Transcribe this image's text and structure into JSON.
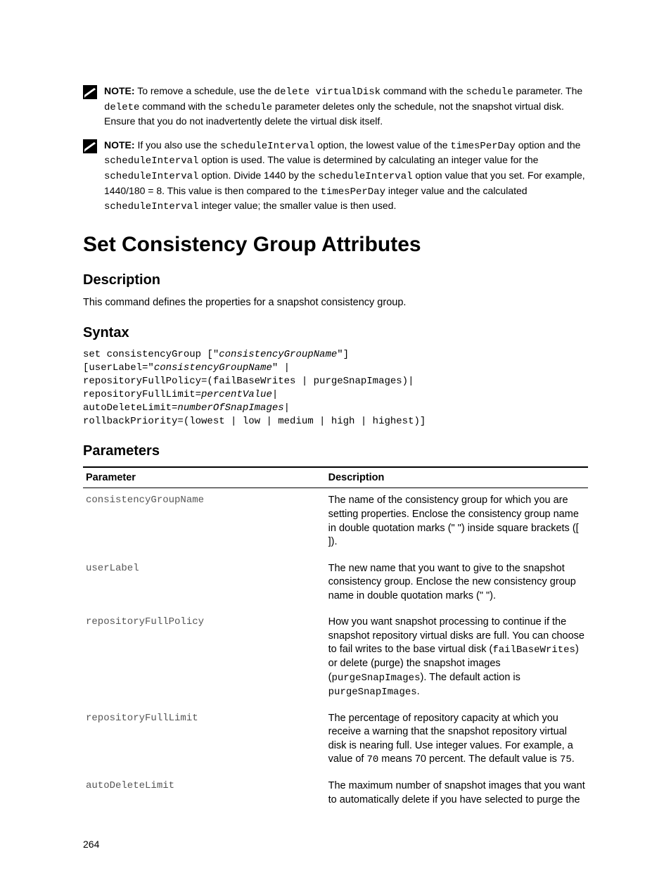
{
  "notes": [
    {
      "label": "NOTE:",
      "segments": [
        {
          "t": "plain",
          "v": " To remove a schedule, use the "
        },
        {
          "t": "mono",
          "v": "delete virtualDisk"
        },
        {
          "t": "plain",
          "v": " command with the "
        },
        {
          "t": "mono",
          "v": "schedule"
        },
        {
          "t": "plain",
          "v": " parameter. The "
        },
        {
          "t": "mono",
          "v": "delete"
        },
        {
          "t": "plain",
          "v": " command with the "
        },
        {
          "t": "mono",
          "v": "schedule"
        },
        {
          "t": "plain",
          "v": " parameter deletes only the schedule, not the snapshot virtual disk. Ensure that you do not inadvertently delete the virtual disk itself."
        }
      ]
    },
    {
      "label": "NOTE:",
      "segments": [
        {
          "t": "plain",
          "v": " If you also use the "
        },
        {
          "t": "mono",
          "v": "scheduleInterval"
        },
        {
          "t": "plain",
          "v": " option, the lowest value of the "
        },
        {
          "t": "mono",
          "v": "timesPerDay"
        },
        {
          "t": "plain",
          "v": " option and the "
        },
        {
          "t": "mono",
          "v": "scheduleInterval"
        },
        {
          "t": "plain",
          "v": " option is used. The value is determined by calculating an integer value for the "
        },
        {
          "t": "mono",
          "v": "scheduleInterval"
        },
        {
          "t": "plain",
          "v": " option. Divide 1440 by the "
        },
        {
          "t": "mono",
          "v": "scheduleInterval"
        },
        {
          "t": "plain",
          "v": " option value that you set. For example, 1440/180 = 8. This value is then compared to the "
        },
        {
          "t": "mono",
          "v": "timesPerDay"
        },
        {
          "t": "plain",
          "v": " integer value and the calculated "
        },
        {
          "t": "mono",
          "v": "scheduleInterval"
        },
        {
          "t": "plain",
          "v": " integer value; the smaller value is then used."
        }
      ]
    }
  ],
  "h1": "Set Consistency Group Attributes",
  "sections": {
    "description_heading": "Description",
    "description_body": "This command defines the properties for a snapshot consistency group.",
    "syntax_heading": "Syntax",
    "syntax_lines": [
      [
        {
          "t": "plain",
          "v": "set consistencyGroup [\""
        },
        {
          "t": "ital",
          "v": "consistencyGroupName"
        },
        {
          "t": "plain",
          "v": "\"]"
        }
      ],
      [
        {
          "t": "plain",
          "v": "[userLabel=\""
        },
        {
          "t": "ital",
          "v": "consistencyGroupName"
        },
        {
          "t": "plain",
          "v": "\" |"
        }
      ],
      [
        {
          "t": "plain",
          "v": "repositoryFullPolicy=(failBaseWrites | purgeSnapImages)|"
        }
      ],
      [
        {
          "t": "plain",
          "v": "repositoryFullLimit="
        },
        {
          "t": "ital",
          "v": "percentValue"
        },
        {
          "t": "plain",
          "v": "|"
        }
      ],
      [
        {
          "t": "plain",
          "v": "autoDeleteLimit="
        },
        {
          "t": "ital",
          "v": "numberOfSnapImages"
        },
        {
          "t": "plain",
          "v": "|"
        }
      ],
      [
        {
          "t": "plain",
          "v": "rollbackPriority=(lowest | low | medium | high | highest)]"
        }
      ]
    ],
    "parameters_heading": "Parameters"
  },
  "table": {
    "headers": [
      "Parameter",
      "Description"
    ],
    "rows": [
      {
        "param": "consistencyGroupName",
        "desc_segments": [
          {
            "t": "plain",
            "v": "The name of the consistency group for which you are setting properties. Enclose the consistency group name in double quotation marks (\" \") inside square brackets ([ ])."
          }
        ]
      },
      {
        "param": "userLabel",
        "desc_segments": [
          {
            "t": "plain",
            "v": "The new name that you want to give to the snapshot consistency group. Enclose the new consistency group name in double quotation marks (\" \")."
          }
        ]
      },
      {
        "param": "repositoryFullPolicy",
        "desc_segments": [
          {
            "t": "plain",
            "v": "How you want snapshot processing to continue if the snapshot repository virtual disks are full. You can choose to fail writes to the base virtual disk ("
          },
          {
            "t": "mono",
            "v": "failBaseWrites"
          },
          {
            "t": "plain",
            "v": ") or delete (purge) the snapshot images ("
          },
          {
            "t": "mono",
            "v": "purgeSnapImages"
          },
          {
            "t": "plain",
            "v": "). The default action is "
          },
          {
            "t": "mono",
            "v": "purgeSnapImages"
          },
          {
            "t": "plain",
            "v": "."
          }
        ]
      },
      {
        "param": "repositoryFullLimit",
        "desc_segments": [
          {
            "t": "plain",
            "v": "The percentage of repository capacity at which you receive a warning that the snapshot repository virtual disk is nearing full. Use integer values. For example, a value of "
          },
          {
            "t": "mono",
            "v": "70"
          },
          {
            "t": "plain",
            "v": " means 70 percent. The default value is "
          },
          {
            "t": "mono",
            "v": "75"
          },
          {
            "t": "plain",
            "v": "."
          }
        ]
      },
      {
        "param": "autoDeleteLimit",
        "desc_segments": [
          {
            "t": "plain",
            "v": "The maximum number of snapshot images that you want to automatically delete if you have selected to purge the"
          }
        ]
      }
    ]
  },
  "page_number": "264"
}
